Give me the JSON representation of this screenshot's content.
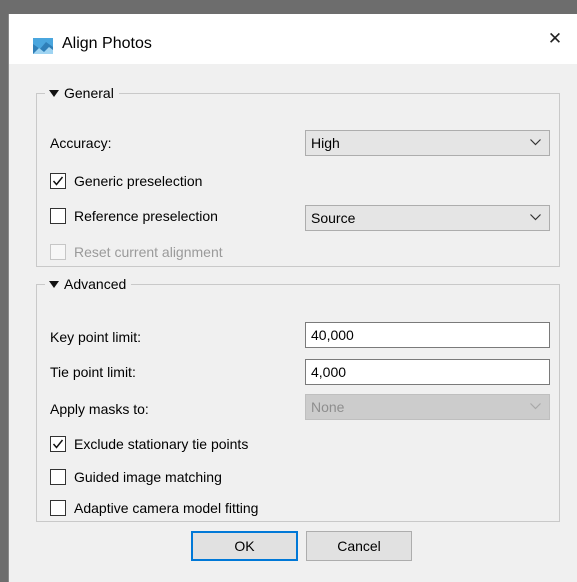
{
  "window": {
    "title": "Align Photos",
    "close_glyph": "✕",
    "app_icon": "photo-landscape-icon",
    "accent": "#0078d7"
  },
  "general": {
    "legend": "General",
    "accuracy_label": "Accuracy:",
    "accuracy_value": "High",
    "generic_preselection_label": "Generic preselection",
    "generic_preselection_checked": true,
    "reference_preselection_label": "Reference preselection",
    "reference_preselection_checked": false,
    "reference_value": "Source",
    "reset_alignment_label": "Reset current alignment",
    "reset_alignment_checked": false
  },
  "advanced": {
    "legend": "Advanced",
    "key_point_label": "Key point limit:",
    "key_point_value": "40,000",
    "tie_point_label": "Tie point limit:",
    "tie_point_value": "4,000",
    "apply_masks_label": "Apply masks to:",
    "apply_masks_value": "None",
    "exclude_stationary_label": "Exclude stationary tie points",
    "exclude_stationary_checked": true,
    "guided_matching_label": "Guided image matching",
    "guided_matching_checked": false,
    "adaptive_fitting_label": "Adaptive camera model fitting",
    "adaptive_fitting_checked": false
  },
  "buttons": {
    "ok_label": "OK",
    "cancel_label": "Cancel"
  }
}
